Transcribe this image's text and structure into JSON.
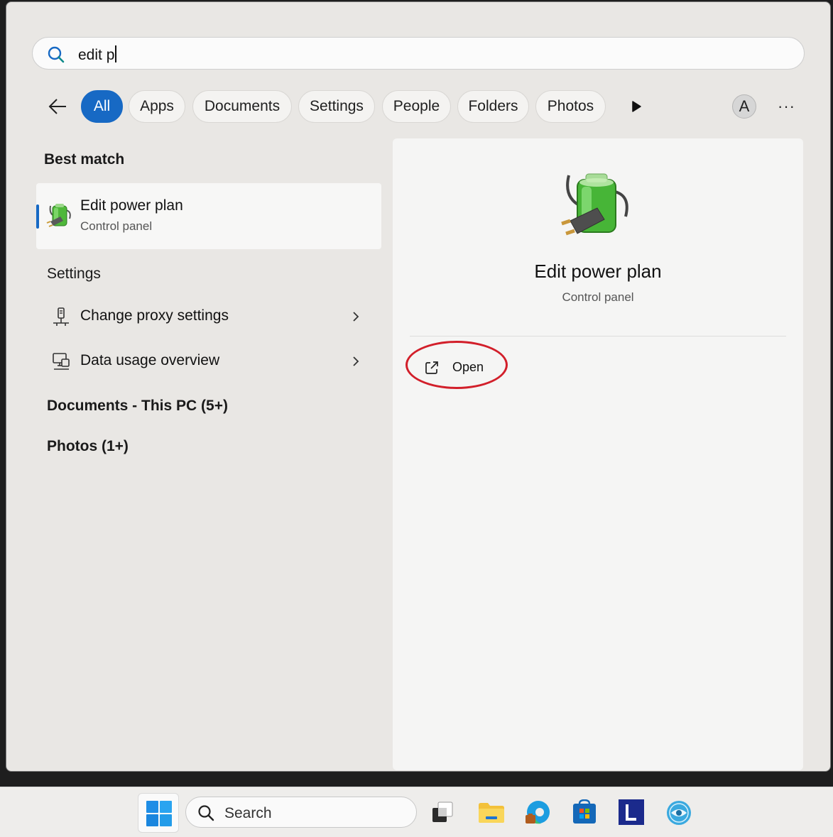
{
  "search": {
    "query": "edit p"
  },
  "filters": {
    "chips": [
      "All",
      "Apps",
      "Documents",
      "Settings",
      "People",
      "Folders",
      "Photos"
    ],
    "active": "All",
    "avatar_letter": "A",
    "more_label": "···"
  },
  "results": {
    "best_match_heading": "Best match",
    "best_match": {
      "title": "Edit power plan",
      "subtitle": "Control panel",
      "icon": "power-plan-battery-icon"
    },
    "settings_heading": "Settings",
    "settings_items": [
      {
        "label": "Change proxy settings",
        "icon": "proxy-network-icon"
      },
      {
        "label": "Data usage overview",
        "icon": "data-usage-monitor-icon"
      }
    ],
    "documents_heading": "Documents - This PC (5+)",
    "photos_heading": "Photos (1+)"
  },
  "detail": {
    "title": "Edit power plan",
    "subtitle": "Control panel",
    "open_label": "Open",
    "annotation_color": "#d21f2a"
  },
  "taskbar": {
    "search_placeholder": "Search",
    "apps": [
      "task-view-icon",
      "file-explorer-icon",
      "edge-icon",
      "microsoft-store-icon",
      "l-app-icon",
      "eye-app-icon"
    ]
  },
  "colors": {
    "accent": "#1769c4"
  }
}
